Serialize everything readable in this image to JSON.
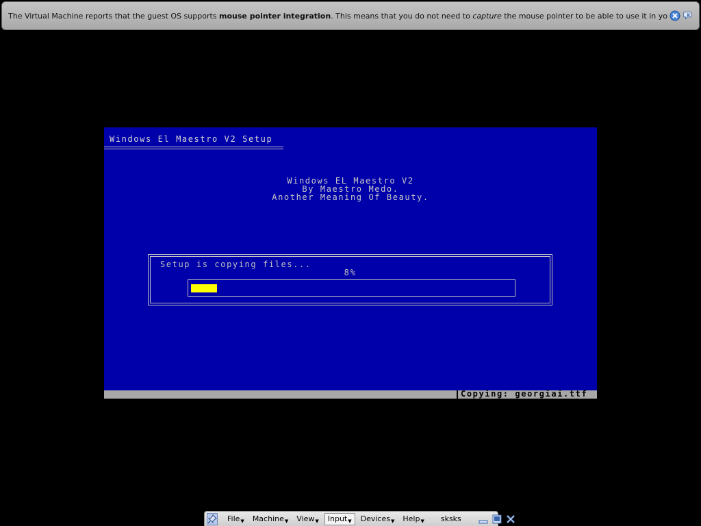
{
  "notification": {
    "text_1": "The Virtual Machine reports that the guest OS supports ",
    "text_bold": "mouse pointer integration",
    "text_2": ". This means that you do not need to ",
    "text_italic": "capture",
    "text_3": " the mouse pointer to be able to use it in your guest OS -- all mouse",
    "close_icon": "close-icon",
    "dont_show_icon": "dont-show-again-icon"
  },
  "vm_screen": {
    "setup_title": "Windows El Maestro V2 Setup",
    "banner": [
      "Windows EL Maestro V2",
      "By Maestro Medo.",
      "Another Meaning Of Beauty."
    ],
    "copy_label": "Setup is copying files...",
    "progress_text": "8%",
    "progress_value": 0.08,
    "status_text": "Copying: georgiai.ttf",
    "colors": {
      "background": "#0000aa",
      "progress": "#ffff00",
      "status_bar": "#a8a8a8"
    }
  },
  "toolbar": {
    "pin_icon": "pin-icon",
    "menus": [
      "File",
      "Machine",
      "View",
      "Input",
      "Devices",
      "Help"
    ],
    "active_menu": "Input",
    "vm_name": "sksks",
    "minimize_icon": "minimize-icon",
    "restore_icon": "restore-icon",
    "close_icon": "close-icon"
  }
}
